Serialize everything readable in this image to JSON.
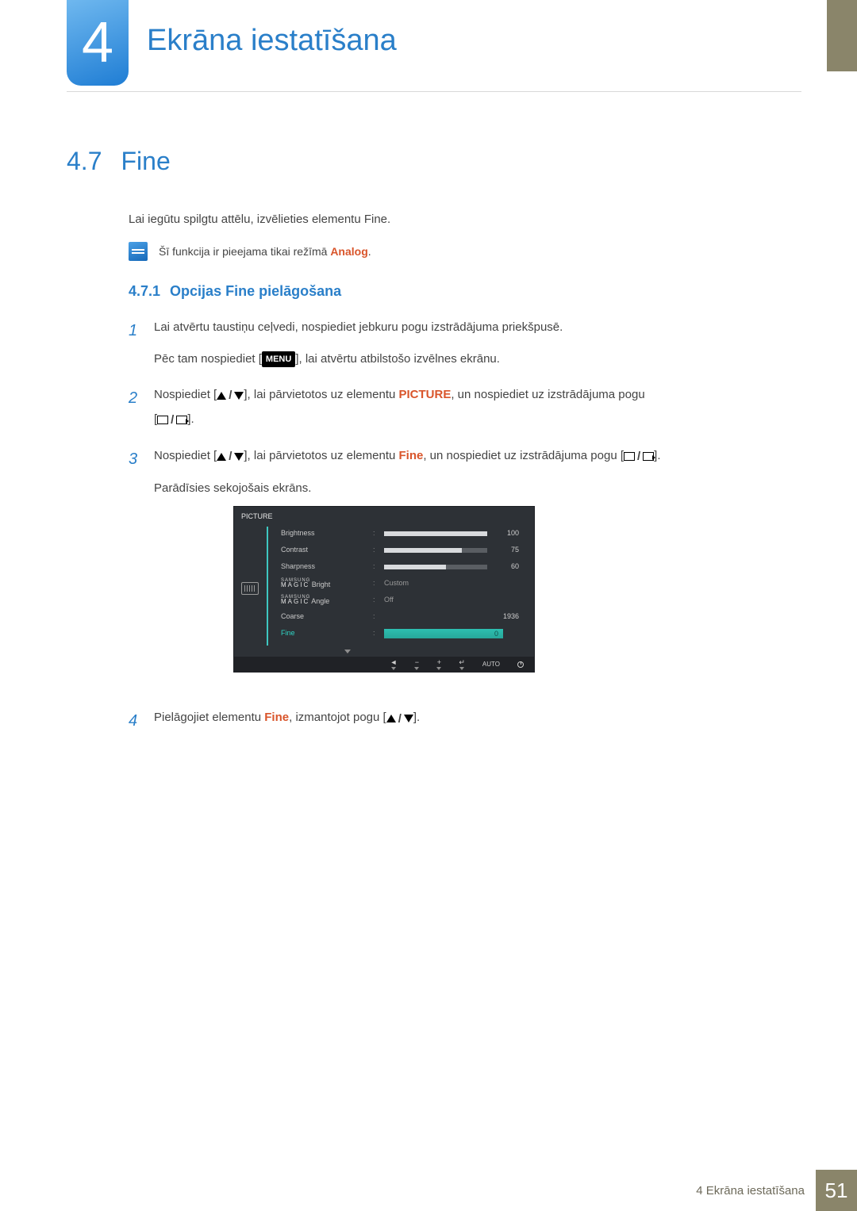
{
  "chapter": {
    "number": "4",
    "title": "Ekrāna iestatīšana"
  },
  "section": {
    "number": "4.7",
    "title": "Fine"
  },
  "intro": "Lai iegūtu spilgtu attēlu, izvēlieties elementu Fine.",
  "note": {
    "prefix": "Šī funkcija ir pieejama tikai režīmā ",
    "kw": "Analog",
    "suffix": "."
  },
  "subsection": {
    "number": "4.7.1",
    "title": "Opcijas Fine pielāgošana"
  },
  "steps": {
    "s1": {
      "num": "1",
      "line1": "Lai atvērtu taustiņu ceļvedi, nospiediet jebkuru pogu izstrādājuma priekšpusē.",
      "line2a": "Pēc tam nospiediet [",
      "menu": "MENU",
      "line2b": "], lai atvērtu atbilstošo izvēlnes ekrānu."
    },
    "s2": {
      "num": "2",
      "a": "Nospiediet [",
      "b": "], lai pārvietotos uz elementu ",
      "kw": "PICTURE",
      "c": ", un nospiediet uz izstrādājuma pogu",
      "d": "[",
      "e": "]."
    },
    "s3": {
      "num": "3",
      "a": "Nospiediet [",
      "b": "], lai pārvietotos uz elementu ",
      "kw": "Fine",
      "c": ", un nospiediet uz izstrādājuma pogu [",
      "d": "].",
      "line2": "Parādīsies sekojošais ekrāns."
    },
    "s4": {
      "num": "4",
      "a": "Pielāgojiet elementu ",
      "kw": "Fine",
      "b": ", izmantojot pogu [",
      "c": "]."
    }
  },
  "osd": {
    "title": "PICTURE",
    "rows": {
      "brightness": {
        "label": "Brightness",
        "value": "100",
        "pct": 100
      },
      "contrast": {
        "label": "Contrast",
        "value": "75",
        "pct": 75
      },
      "sharpness": {
        "label": "Sharpness",
        "value": "60",
        "pct": 60
      },
      "magicbright": {
        "samsung": "SAMSUNG",
        "magic": "MAGIC",
        "suffix": "Bright",
        "value": "Custom"
      },
      "magicangle": {
        "samsung": "SAMSUNG",
        "magic": "MAGIC",
        "suffix": "Angle",
        "value": "Off"
      },
      "coarse": {
        "label": "Coarse",
        "value": "1936"
      },
      "fine": {
        "label": "Fine",
        "value": "0"
      }
    },
    "footer": {
      "back": "◄",
      "minus": "−",
      "plus": "+",
      "enter": "↵",
      "auto": "AUTO"
    }
  },
  "footer": {
    "text": "4 Ekrāna iestatīšana",
    "page": "51"
  }
}
